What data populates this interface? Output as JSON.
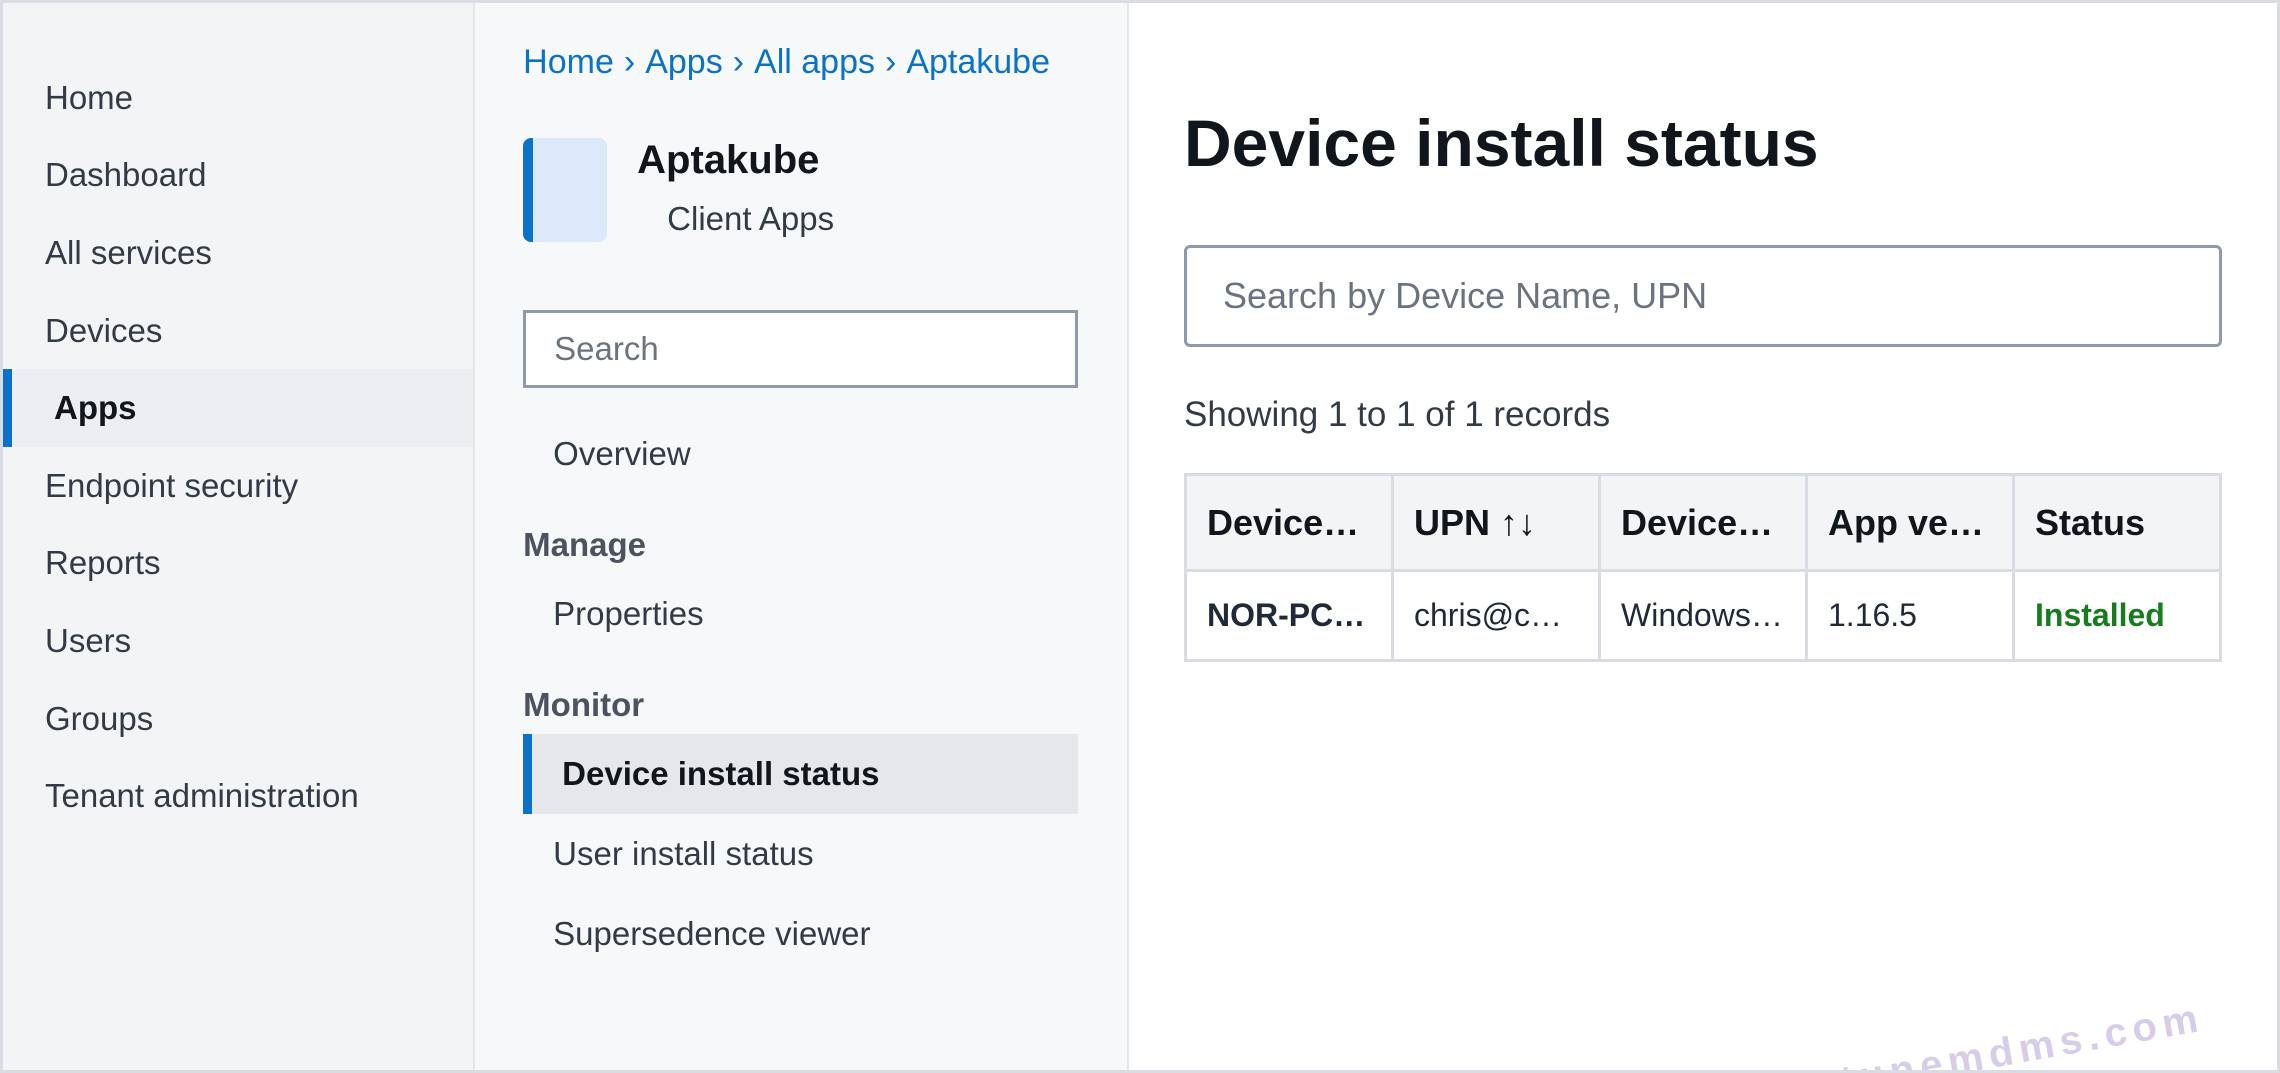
{
  "left_nav": {
    "items": [
      {
        "label": "Home",
        "active": false
      },
      {
        "label": "Dashboard",
        "active": false
      },
      {
        "label": "All services",
        "active": false
      },
      {
        "label": "Devices",
        "active": false
      },
      {
        "label": "Apps",
        "active": true
      },
      {
        "label": "Endpoint security",
        "active": false
      },
      {
        "label": "Reports",
        "active": false
      },
      {
        "label": "Users",
        "active": false
      },
      {
        "label": "Groups",
        "active": false
      },
      {
        "label": "Tenant administration",
        "active": false
      }
    ]
  },
  "breadcrumb": [
    "Home",
    "Apps",
    "All apps",
    "Aptakube"
  ],
  "breadcrumb_separator": "›",
  "app": {
    "title": "Aptakube",
    "subtitle": "Client Apps"
  },
  "mid_panel": {
    "search_placeholder": "Search",
    "overview_label": "Overview",
    "manage_heading": "Manage",
    "properties_label": "Properties",
    "monitor_heading": "Monitor",
    "monitor_items": [
      {
        "label": "Device install status",
        "active": true
      },
      {
        "label": "User install status",
        "active": false
      },
      {
        "label": "Supersedence viewer",
        "active": false
      }
    ]
  },
  "main": {
    "title": "Device install status",
    "search_placeholder": "Search by Device Name, UPN",
    "records_text": "Showing 1 to 1 of 1 records",
    "columns": [
      "Device…",
      "UPN ↑↓",
      "Device…",
      "App ve…",
      "Status"
    ],
    "rows": [
      {
        "device": "NOR-PC…",
        "upn": "chris@c…",
        "os": "Windows…",
        "app_version": "1.16.5",
        "status": "Installed"
      }
    ]
  },
  "watermark": "intunemdms.com",
  "colors": {
    "accent": "#0a72c8",
    "status_installed": "#167c1d",
    "watermark": "#d8cde9"
  }
}
